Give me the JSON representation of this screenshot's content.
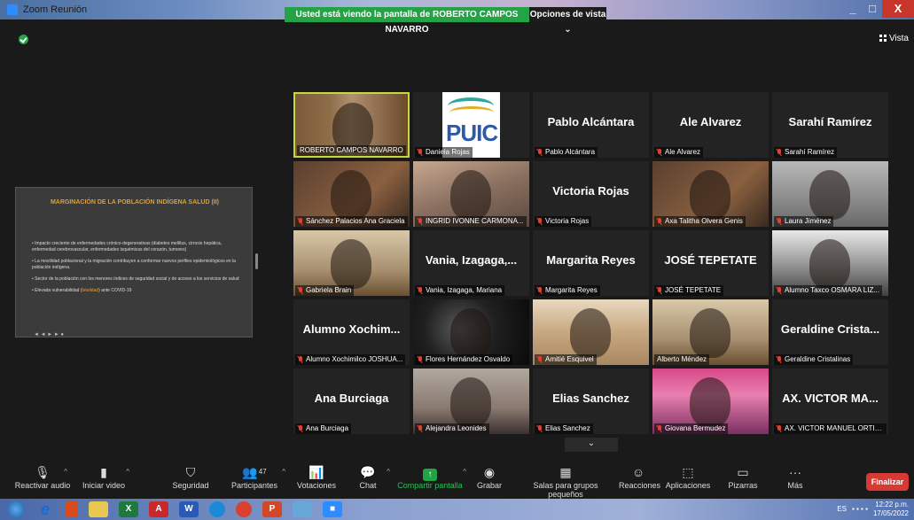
{
  "window": {
    "title": "Zoom Reunión",
    "share_banner": "Usted está viendo la pantalla de ROBERTO CAMPOS NAVARRO",
    "view_options": "Opciones de vista ⌄",
    "minimize": "_",
    "maximize": "□",
    "close": "X"
  },
  "view_button": "Vista",
  "shared_slide": {
    "title": "MARGINACIÓN DE LA POBLACIÓN INDÍGENA SALUD (II)",
    "bullets": [
      "Impacto creciente de enfermedades crónico-degenerativas (diabetes mellitus, cirrosis hepática, enfermedad cerebrovascular, enfermedades isquémicas del corazón, tumores)",
      "La movilidad poblacional y la migración contribuyen a conformar nuevos perfiles epidemiológicos en la población indígena.",
      "Sector de la población con los menores índices de seguridad social y de acceso a los servicios de salud"
    ],
    "last_bullet_pre": "Elevada vulnerabilidad (",
    "last_bullet_highlight": "letalidad",
    "last_bullet_post": ") ante COVID-19",
    "nav": "◄ ◄ ► ► ●"
  },
  "tiles": [
    {
      "label": "ROBERTO CAMPOS NAVARRO",
      "big": "",
      "muted": false
    },
    {
      "label": "Daniela Rojas",
      "big": "",
      "muted": true
    },
    {
      "label": "Pablo Alcántara",
      "big": "Pablo Alcántara",
      "muted": true
    },
    {
      "label": "Ale Alvarez",
      "big": "Ale Alvarez",
      "muted": true
    },
    {
      "label": "Sarahí Ramírez",
      "big": "Sarahí Ramírez",
      "muted": true
    },
    {
      "label": "Sánchez Palacios Ana Graciela",
      "big": "",
      "muted": true
    },
    {
      "label": "INGRID IVONNE CARMONA...",
      "big": "",
      "muted": true
    },
    {
      "label": "Victoria Rojas",
      "big": "Victoria Rojas",
      "muted": true
    },
    {
      "label": "Axa Talitha Olvera Genis",
      "big": "",
      "muted": true
    },
    {
      "label": "Laura Jiménez",
      "big": "",
      "muted": true
    },
    {
      "label": "Gabriela Brain",
      "big": "",
      "muted": true
    },
    {
      "label": "Vania, Izagaga, Mariana",
      "big": "Vania, Izagaga,...",
      "muted": true
    },
    {
      "label": "Margarita Reyes",
      "big": "Margarita Reyes",
      "muted": true
    },
    {
      "label": "JOSÉ TEPETATE",
      "big": "JOSÉ TEPETATE",
      "muted": true
    },
    {
      "label": "Alumno Taxco OSMARA LIZ...",
      "big": "",
      "muted": true
    },
    {
      "label": "Alumno Xochimilco JOSHUA...",
      "big": "Alumno Xochim...",
      "muted": true
    },
    {
      "label": "Flores Hernández Osvaldo",
      "big": "",
      "muted": true
    },
    {
      "label": "Amitié Esquivel",
      "big": "",
      "muted": true
    },
    {
      "label": "Alberto Méndez",
      "big": "",
      "muted": false
    },
    {
      "label": "Geraldine Cristalinas",
      "big": "Geraldine Crista...",
      "muted": true
    },
    {
      "label": "Ana Burciaga",
      "big": "Ana Burciaga",
      "muted": true
    },
    {
      "label": "Alejandra Leonides",
      "big": "",
      "muted": true
    },
    {
      "label": "Elias Sanchez",
      "big": "Elias Sanchez",
      "muted": true
    },
    {
      "label": "Giovana Bermudez",
      "big": "",
      "muted": true
    },
    {
      "label": "AX. VICTOR MANUEL ORTIG...",
      "big": "AX. VICTOR MA...",
      "muted": true
    }
  ],
  "more_chevron": "⌄",
  "toolbar": {
    "unmute": "Reactivar audio",
    "start_video": "Iniciar video",
    "security": "Seguridad",
    "participants": "Participantes",
    "participants_count": "47",
    "polls": "Votaciones",
    "chat": "Chat",
    "share": "Compartir pantalla",
    "record": "Grabar",
    "breakout": "Salas para grupos pequeños",
    "reactions": "Reacciones",
    "apps": "Aplicaciones",
    "whiteboards": "Pizarras",
    "more": "Más",
    "end": "Finalizar"
  },
  "taskbar": {
    "language": "ES",
    "time": "12:22 p.m.",
    "date": "17/05/2022"
  }
}
